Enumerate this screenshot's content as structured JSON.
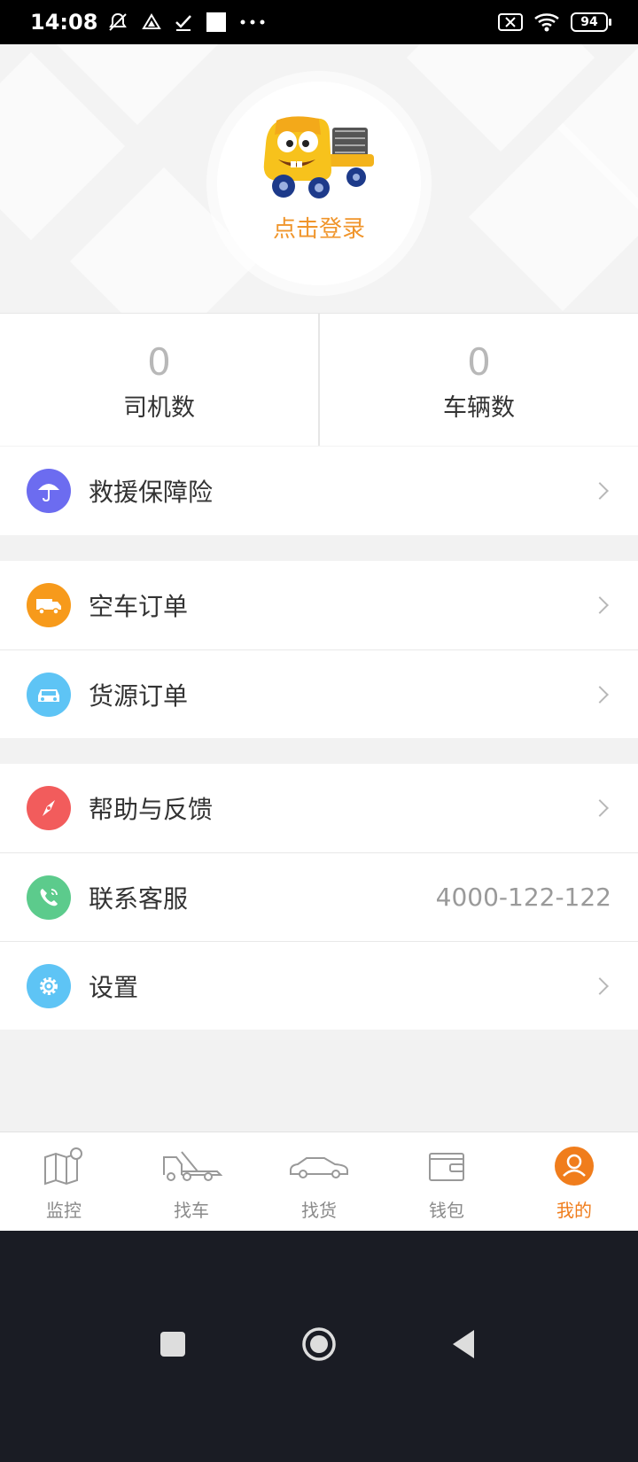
{
  "status_bar": {
    "time": "14:08",
    "battery": "94"
  },
  "header": {
    "login_label": "点击登录"
  },
  "stats": [
    {
      "value": "0",
      "label": "司机数"
    },
    {
      "value": "0",
      "label": "车辆数"
    }
  ],
  "menu": {
    "insurance": {
      "label": "救援保障险",
      "icon": "umbrella-icon",
      "color": "#6c6cf0"
    },
    "empty_truck_orders": {
      "label": "空车订单",
      "icon": "truck-icon",
      "color": "#f79a1b"
    },
    "cargo_orders": {
      "label": "货源订单",
      "icon": "car-icon",
      "color": "#5ec4f5"
    },
    "help": {
      "label": "帮助与反馈",
      "icon": "compass-icon",
      "color": "#f25c5c"
    },
    "customer_service": {
      "label": "联系客服",
      "value": "4000-122-122",
      "icon": "phone-icon",
      "color": "#5ccb8c"
    },
    "settings": {
      "label": "设置",
      "icon": "gear-icon",
      "color": "#5ec4f5"
    }
  },
  "tabbar": {
    "items": [
      {
        "label": "监控",
        "icon": "map-icon"
      },
      {
        "label": "找车",
        "icon": "tow-truck-icon"
      },
      {
        "label": "找货",
        "icon": "car-icon"
      },
      {
        "label": "钱包",
        "icon": "wallet-icon"
      },
      {
        "label": "我的",
        "icon": "user-icon",
        "active": true
      }
    ],
    "active_color": "#f07d1c"
  }
}
